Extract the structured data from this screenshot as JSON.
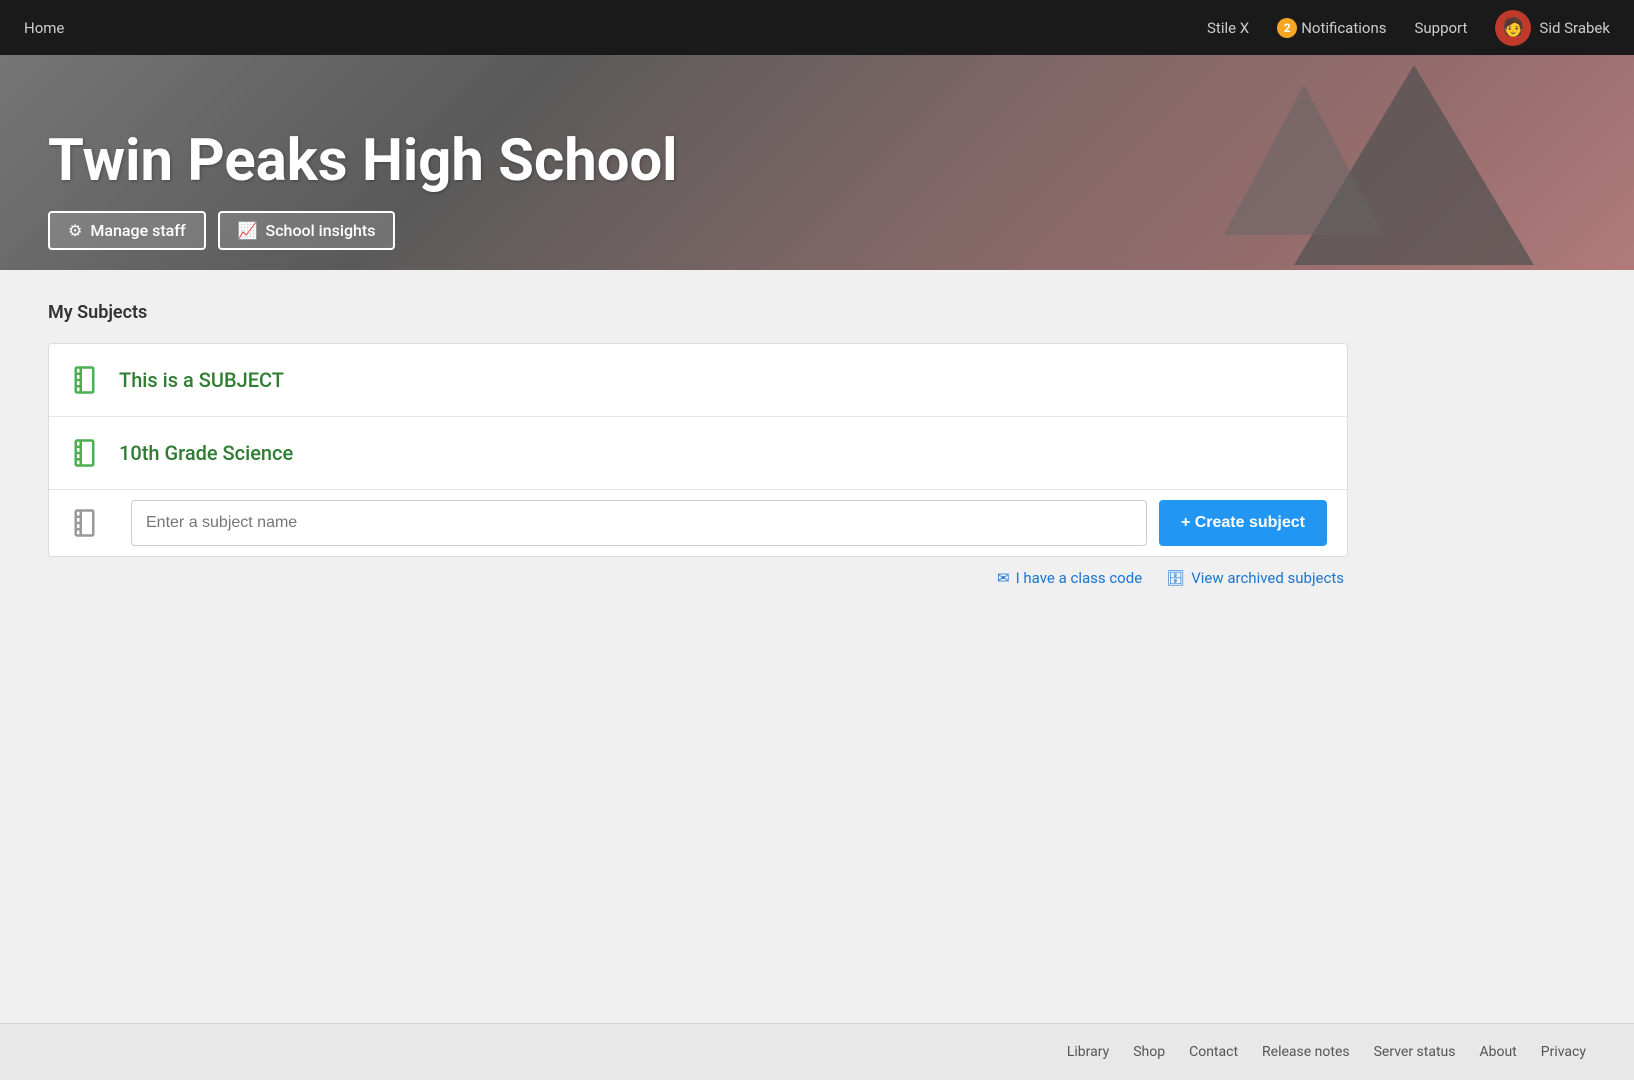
{
  "topnav": {
    "home_label": "Home",
    "stile_label": "Stile X",
    "notifications_label": "Notifications",
    "notifications_count": "2",
    "support_label": "Support",
    "user_name": "Sid Srabek"
  },
  "hero": {
    "school_name": "Twin Peaks High School",
    "manage_staff_label": "Manage staff",
    "school_insights_label": "School insights"
  },
  "subjects_section": {
    "title": "My Subjects",
    "subjects": [
      {
        "name": "This is a SUBJECT"
      },
      {
        "name": "10th Grade Science"
      }
    ],
    "create_placeholder": "Enter a subject name",
    "create_button_label": "+ Create subject",
    "class_code_label": "I have a class code",
    "view_archived_label": "View archived subjects"
  },
  "footer": {
    "links": [
      {
        "label": "Library"
      },
      {
        "label": "Shop"
      },
      {
        "label": "Contact"
      },
      {
        "label": "Release notes"
      },
      {
        "label": "Server status"
      },
      {
        "label": "About"
      },
      {
        "label": "Privacy"
      }
    ]
  },
  "icons": {
    "gear": "⚙",
    "chart": "📈",
    "envelope": "✉",
    "archive": "🗄"
  },
  "colors": {
    "subject_green": "#2e7d32",
    "create_blue": "#2196F3",
    "link_blue": "#1976D2",
    "notification_orange": "#f5a623"
  }
}
